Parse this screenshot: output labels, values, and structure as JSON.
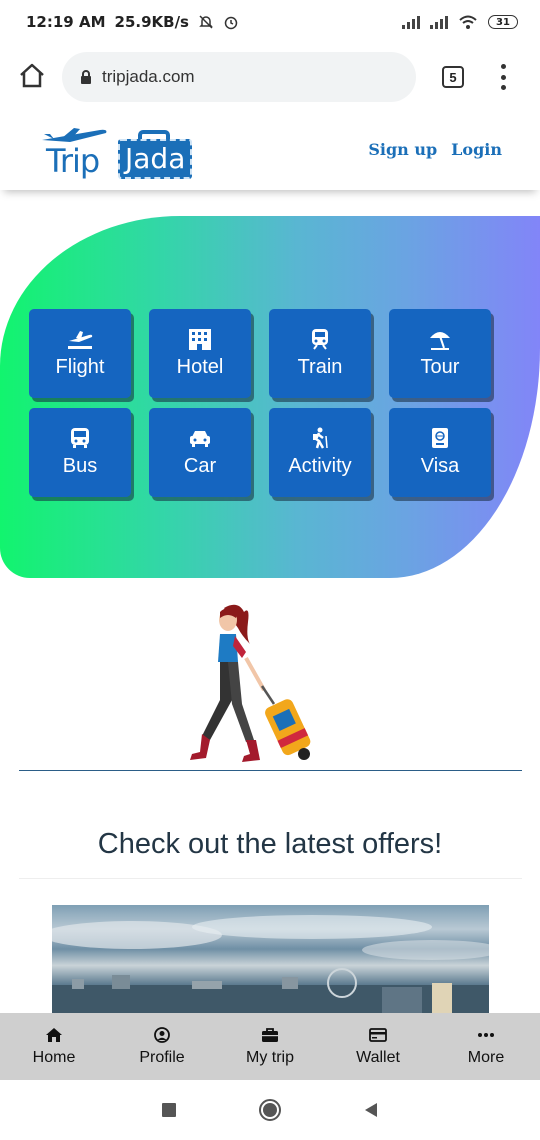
{
  "status_bar": {
    "time": "12:19 AM",
    "net_speed": "25.9KB/s",
    "battery": "31",
    "icons": [
      "notification-off-icon",
      "alarm-icon",
      "signal-icon",
      "signal-icon",
      "wifi-icon",
      "battery-icon"
    ]
  },
  "browser": {
    "url": "tripjada.com",
    "tab_count": "5",
    "icons": [
      "home-icon",
      "lock-icon",
      "more-vertical-icon"
    ]
  },
  "header": {
    "logo_trip": "Trip",
    "logo_jada": "Jada",
    "signup": "Sign up",
    "login": "Login",
    "brand_color": "#1b6fb8"
  },
  "services": [
    {
      "label": "Flight",
      "icon": "flight-icon"
    },
    {
      "label": "Hotel",
      "icon": "hotel-icon"
    },
    {
      "label": "Train",
      "icon": "train-icon"
    },
    {
      "label": "Tour",
      "icon": "beach-umbrella-icon"
    },
    {
      "label": "Bus",
      "icon": "bus-icon"
    },
    {
      "label": "Car",
      "icon": "car-icon"
    },
    {
      "label": "Activity",
      "icon": "hiking-icon"
    },
    {
      "label": "Visa",
      "icon": "passport-icon"
    }
  ],
  "offers": {
    "title": "Check out the latest offers!"
  },
  "bottom_nav": [
    {
      "label": "Home",
      "icon": "home-icon"
    },
    {
      "label": "Profile",
      "icon": "user-circle-icon"
    },
    {
      "label": "My trip",
      "icon": "briefcase-icon"
    },
    {
      "label": "Wallet",
      "icon": "wallet-icon"
    },
    {
      "label": "More",
      "icon": "more-horizontal-icon"
    }
  ],
  "colors": {
    "service_tile": "#1565c0",
    "hero_gradient_start": "#12f46e",
    "hero_gradient_end": "#8285f8",
    "bottom_nav_bg": "#cfcfcf"
  }
}
